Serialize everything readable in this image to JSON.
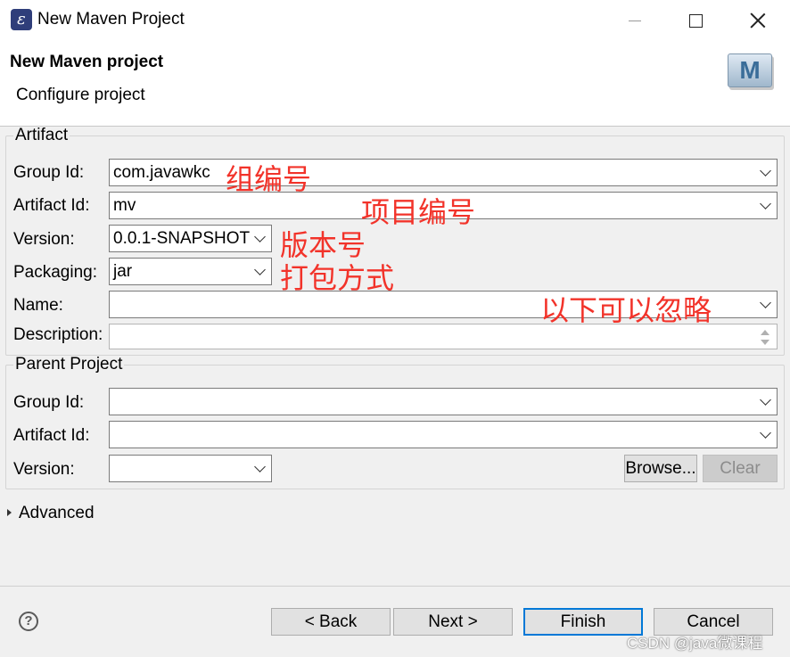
{
  "window": {
    "title": "New Maven Project"
  },
  "header": {
    "title": "New Maven project",
    "subtitle": "Configure project"
  },
  "artifact_group": {
    "legend": "Artifact",
    "group_id": {
      "label": "Group Id:",
      "value": "com.javawkc"
    },
    "artifact_id": {
      "label": "Artifact Id:",
      "value": "mv"
    },
    "version": {
      "label": "Version:",
      "value": "0.0.1-SNAPSHOT"
    },
    "packaging": {
      "label": "Packaging:",
      "value": "jar"
    },
    "name": {
      "label": "Name:",
      "value": ""
    },
    "description": {
      "label": "Description:",
      "value": ""
    }
  },
  "parent_group": {
    "legend": "Parent Project",
    "group_id": {
      "label": "Group Id:",
      "value": ""
    },
    "artifact_id": {
      "label": "Artifact Id:",
      "value": ""
    },
    "version": {
      "label": "Version:",
      "value": ""
    },
    "browse_label": "Browse...",
    "clear_label": "Clear"
  },
  "advanced": {
    "label": "Advanced"
  },
  "buttons": {
    "back": "< Back",
    "next": "Next >",
    "finish": "Finish",
    "cancel": "Cancel"
  },
  "annotations": {
    "group_id_note": "组编号",
    "artifact_id_note": "项目编号",
    "version_note": "版本号",
    "packaging_note": "打包方式",
    "optional_note": "以下可以忽略"
  },
  "watermark": "CSDN @java微课程",
  "icons": {
    "app": "eclipse-icon",
    "maven": "maven-m-icon",
    "help": "question-mark-icon"
  },
  "colors": {
    "annotation": "#f2332a",
    "default_button_border": "#0078d7"
  }
}
